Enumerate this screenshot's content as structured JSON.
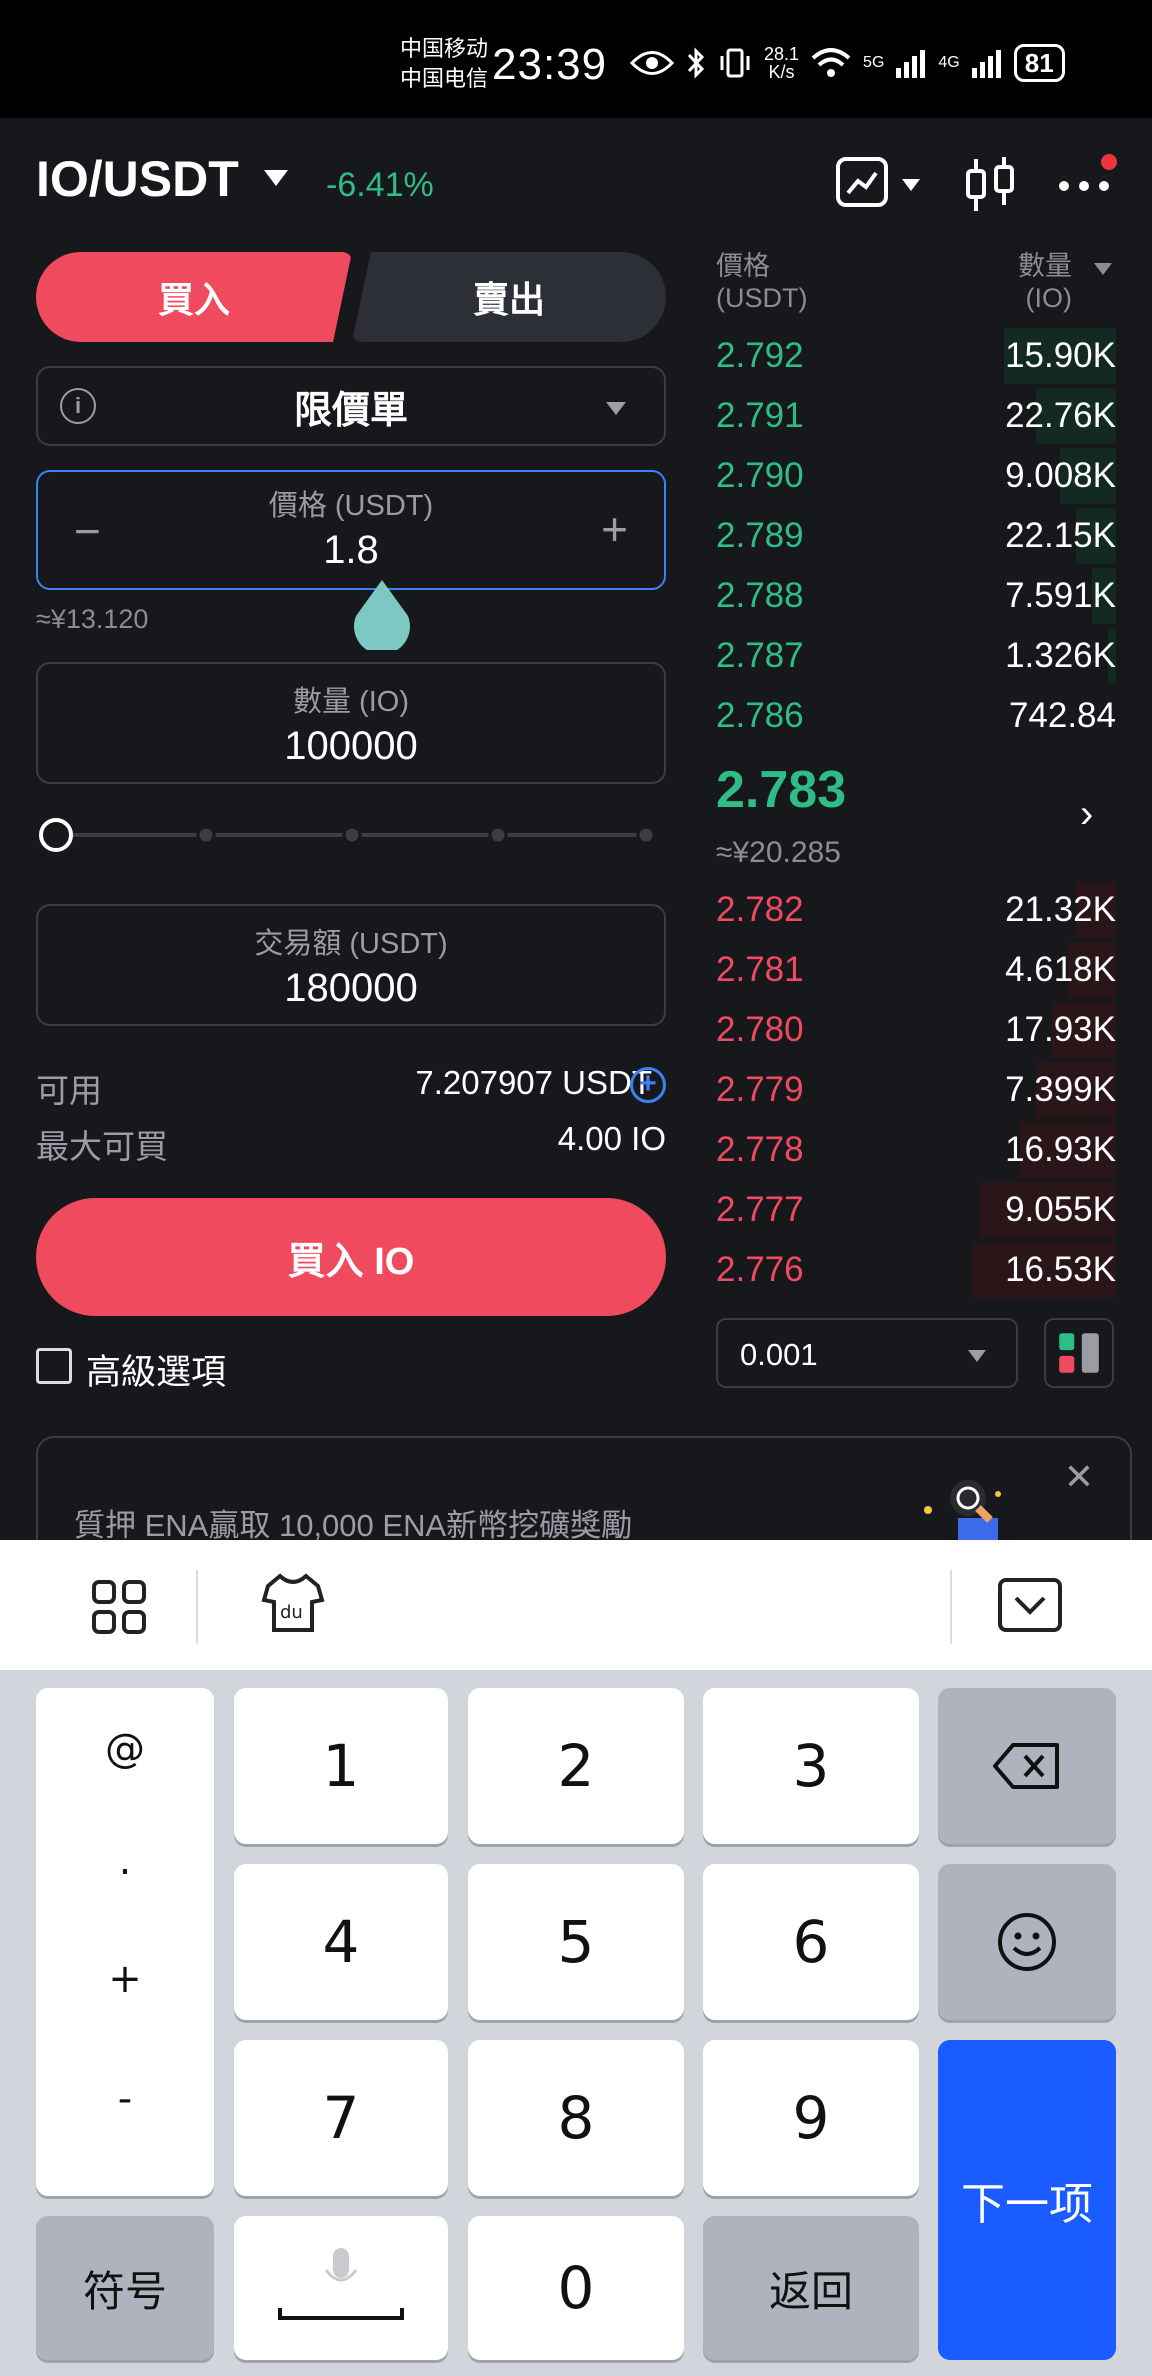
{
  "status_bar": {
    "carrier1": "中国移动",
    "carrier2": "中国电信",
    "time": "23:39",
    "net_speed_value": "28.1",
    "net_speed_unit": "K/s",
    "net1": "5G",
    "net2": "4G",
    "battery": "81"
  },
  "header": {
    "pair": "IO/USDT",
    "change": "-6.41%"
  },
  "trade_form": {
    "buy_tab": "買入",
    "sell_tab": "賣出",
    "order_type": "限價單",
    "price_label": "價格 (USDT)",
    "price_value": "1.8",
    "price_cny": "≈¥13.120",
    "qty_label": "數量 (IO)",
    "qty_value": "100000",
    "total_label": "交易額 (USDT)",
    "total_value": "180000",
    "available_label": "可用",
    "available_value": "7.207907 USDT",
    "max_buy_label": "最大可買",
    "max_buy_value": "4.00 IO",
    "buy_button": "買入 IO",
    "advanced_label": "高級選項",
    "slider_percent": 0
  },
  "order_book": {
    "header_price": "價格",
    "header_price_unit": "(USDT)",
    "header_qty": "數量",
    "header_qty_unit": "(IO)",
    "asks": [
      {
        "price": "2.792",
        "qty": "15.90K",
        "depth": 0.28
      },
      {
        "price": "2.791",
        "qty": "22.76K",
        "depth": 0.2
      },
      {
        "price": "2.790",
        "qty": "9.008K",
        "depth": 0.14
      },
      {
        "price": "2.789",
        "qty": "22.15K",
        "depth": 0.1
      },
      {
        "price": "2.788",
        "qty": "7.591K",
        "depth": 0.06
      },
      {
        "price": "2.787",
        "qty": "1.326K",
        "depth": 0.02
      },
      {
        "price": "2.786",
        "qty": "742.84",
        "depth": 0.0
      }
    ],
    "last_price": "2.783",
    "last_price_cny": "≈¥20.285",
    "bids": [
      {
        "price": "2.782",
        "qty": "21.32K",
        "depth": 0.1
      },
      {
        "price": "2.781",
        "qty": "4.618K",
        "depth": 0.12
      },
      {
        "price": "2.780",
        "qty": "17.93K",
        "depth": 0.16
      },
      {
        "price": "2.779",
        "qty": "7.399K",
        "depth": 0.2
      },
      {
        "price": "2.778",
        "qty": "16.93K",
        "depth": 0.24
      },
      {
        "price": "2.777",
        "qty": "9.055K",
        "depth": 0.34
      },
      {
        "price": "2.776",
        "qty": "16.53K",
        "depth": 0.36
      }
    ],
    "precision": "0.001"
  },
  "banner": {
    "text": "質押 ENA贏取 10,000 ENA新幣挖礦獎勵"
  },
  "keyboard": {
    "symbols": [
      "@",
      ".",
      "+",
      "-"
    ],
    "digits": [
      "1",
      "2",
      "3",
      "4",
      "5",
      "6",
      "7",
      "8",
      "9",
      "0"
    ],
    "symbol_key": "符号",
    "back_key": "返回",
    "next_key": "下一项"
  },
  "colors": {
    "buy": "#f04a5e",
    "up": "#2ebd85",
    "accent": "#3b82f6",
    "next_key": "#1a5cff"
  }
}
